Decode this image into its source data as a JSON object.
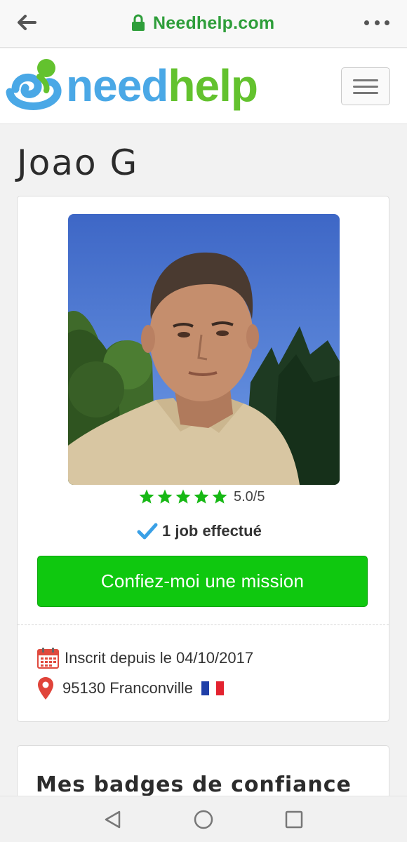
{
  "browser": {
    "url": "Needhelp.com"
  },
  "site": {
    "logo_need": "need",
    "logo_help": "help",
    "brand_blue": "#4aa8e6",
    "brand_green": "#63c22e"
  },
  "profile": {
    "name": "Joao G",
    "rating_text": "5.0/5",
    "rating_value": 5,
    "rating_max": 5,
    "jobs_text": "1 job effectué",
    "mission_button": "Confiez-moi une mission",
    "registered": "Inscrit depuis le 04/10/2017",
    "location": "95130 Franconville",
    "accent_green": "#0fc80f"
  },
  "badges": {
    "title": "Mes badges de confiance"
  },
  "icons": [
    "back-arrow-icon",
    "lock-icon",
    "more-dots-icon",
    "hamburger-icon",
    "star-icon",
    "checkmark-icon",
    "calendar-icon",
    "map-pin-icon",
    "france-flag-icon",
    "nav-back-icon",
    "nav-home-icon",
    "nav-recent-icon"
  ]
}
